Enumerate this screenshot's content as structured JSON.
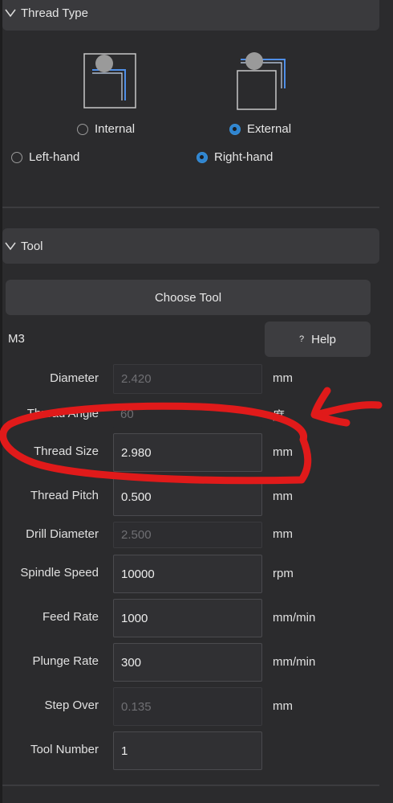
{
  "thread_type": {
    "header": "Thread Type",
    "location": {
      "internal": "Internal",
      "external": "External",
      "selected": "external"
    },
    "hand": {
      "left": "Left-hand",
      "right": "Right-hand",
      "selected": "right"
    }
  },
  "tool": {
    "header": "Tool",
    "choose_tool": "Choose Tool",
    "tool_name": "M3",
    "help": "Help",
    "help_icon": "?"
  },
  "params": [
    {
      "label": "Diameter",
      "value": "2.420",
      "unit": "mm",
      "editable": false
    },
    {
      "label": "Thread Angle",
      "value": "60",
      "unit": "度",
      "editable": false
    },
    {
      "label": "Thread Size",
      "value": "2.980",
      "unit": "mm",
      "editable": true
    },
    {
      "label": "Thread Pitch",
      "value": "0.500",
      "unit": "mm",
      "editable": true
    },
    {
      "label": "Drill Diameter",
      "value": "2.500",
      "unit": "mm",
      "editable": false
    },
    {
      "label": "Spindle Speed",
      "value": "10000",
      "unit": "rpm",
      "editable": true
    },
    {
      "label": "Feed Rate",
      "value": "1000",
      "unit": "mm/min",
      "editable": true
    },
    {
      "label": "Plunge Rate",
      "value": "300",
      "unit": "mm/min",
      "editable": true
    },
    {
      "label": "Step Over",
      "value": "0.135",
      "unit": "mm",
      "editable": false
    },
    {
      "label": "Tool Number",
      "value": "1",
      "unit": "",
      "editable": true
    }
  ],
  "colors": {
    "accent": "#2f85d0",
    "annotation": "#e01a1a"
  }
}
